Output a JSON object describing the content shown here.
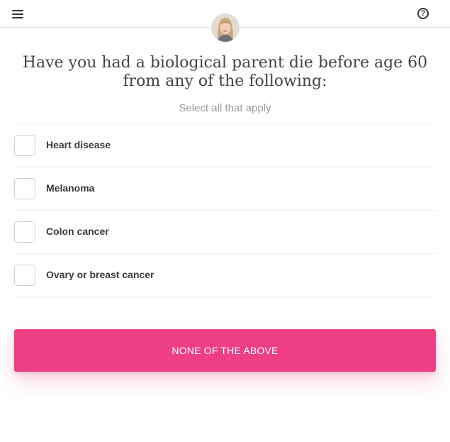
{
  "header": {
    "menu_icon": "hamburger-menu-icon",
    "help_icon": "question-circle-icon",
    "help_glyph": "?"
  },
  "question": {
    "title": "Have you had a biological parent die before age 60 from any of the following:",
    "subtitle": "Select all that apply"
  },
  "options": [
    {
      "label": "Heart disease",
      "checked": false
    },
    {
      "label": "Melanoma",
      "checked": false
    },
    {
      "label": "Colon cancer",
      "checked": false
    },
    {
      "label": "Ovary or breast cancer",
      "checked": false
    }
  ],
  "none_button": {
    "label": "NONE OF THE ABOVE"
  },
  "colors": {
    "accent": "#ee3f84",
    "divider": "#efefef"
  }
}
